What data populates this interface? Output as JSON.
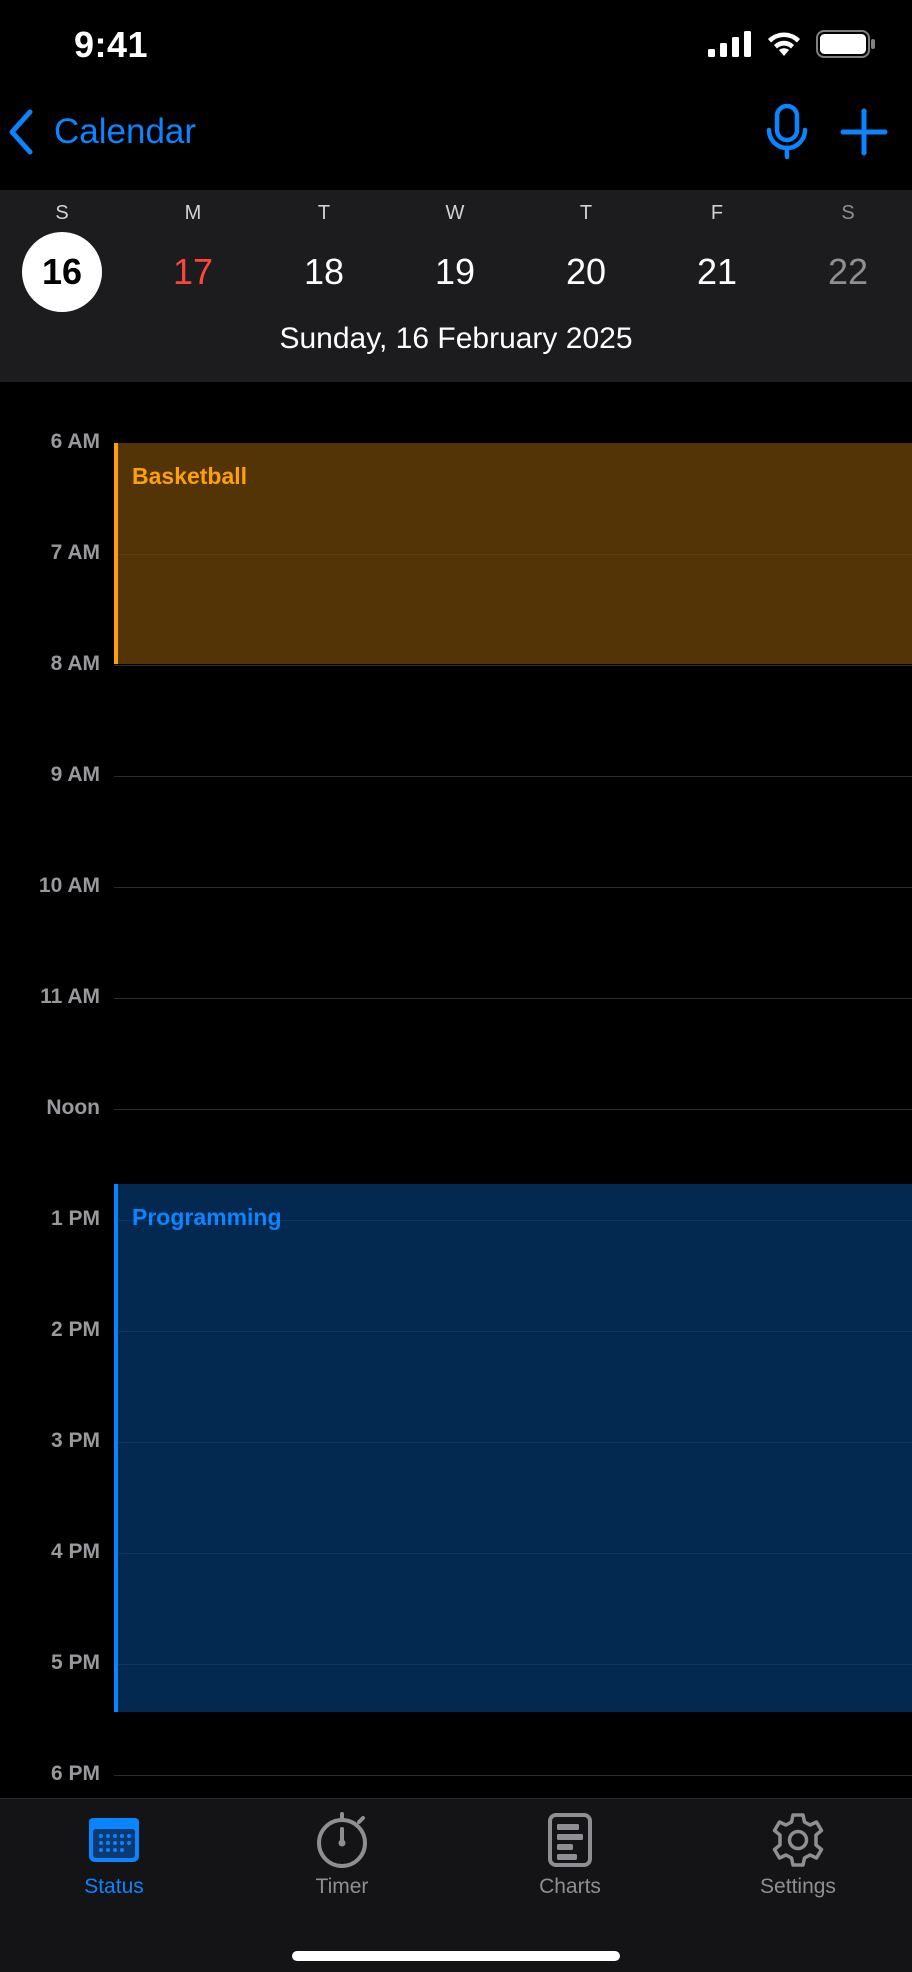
{
  "status_bar": {
    "time": "9:41",
    "icons": [
      "cellular-signal-icon",
      "wifi-icon",
      "battery-icon"
    ]
  },
  "nav": {
    "back_label": "Calendar",
    "actions": [
      "microphone-icon",
      "plus-icon"
    ],
    "accent_color": "#0a84ff"
  },
  "week": {
    "days": [
      {
        "letter": "S",
        "number": "16",
        "state": "selected"
      },
      {
        "letter": "M",
        "number": "17",
        "state": "today"
      },
      {
        "letter": "T",
        "number": "18",
        "state": "normal"
      },
      {
        "letter": "W",
        "number": "19",
        "state": "normal"
      },
      {
        "letter": "T",
        "number": "20",
        "state": "normal"
      },
      {
        "letter": "F",
        "number": "21",
        "state": "normal"
      },
      {
        "letter": "S",
        "number": "22",
        "state": "dim"
      }
    ],
    "full_date": "Sunday, 16 February 2025"
  },
  "timeline": {
    "hours": [
      "6 AM",
      "7 AM",
      "8 AM",
      "9 AM",
      "10 AM",
      "11 AM",
      "Noon",
      "1 PM",
      "2 PM",
      "3 PM",
      "4 PM",
      "5 PM",
      "6 PM"
    ],
    "events": [
      {
        "title": "Basketball",
        "start": "6:00",
        "end": "8:00",
        "color": "#ff9f0a"
      },
      {
        "title": "Programming",
        "start": "12:40",
        "end": "17:25",
        "color": "#0a84ff"
      }
    ]
  },
  "tabs": [
    {
      "label": "Status",
      "icon": "calendar-icon",
      "active": true
    },
    {
      "label": "Timer",
      "icon": "stopwatch-icon",
      "active": false
    },
    {
      "label": "Charts",
      "icon": "chart-document-icon",
      "active": false
    },
    {
      "label": "Settings",
      "icon": "gear-icon",
      "active": false
    }
  ]
}
